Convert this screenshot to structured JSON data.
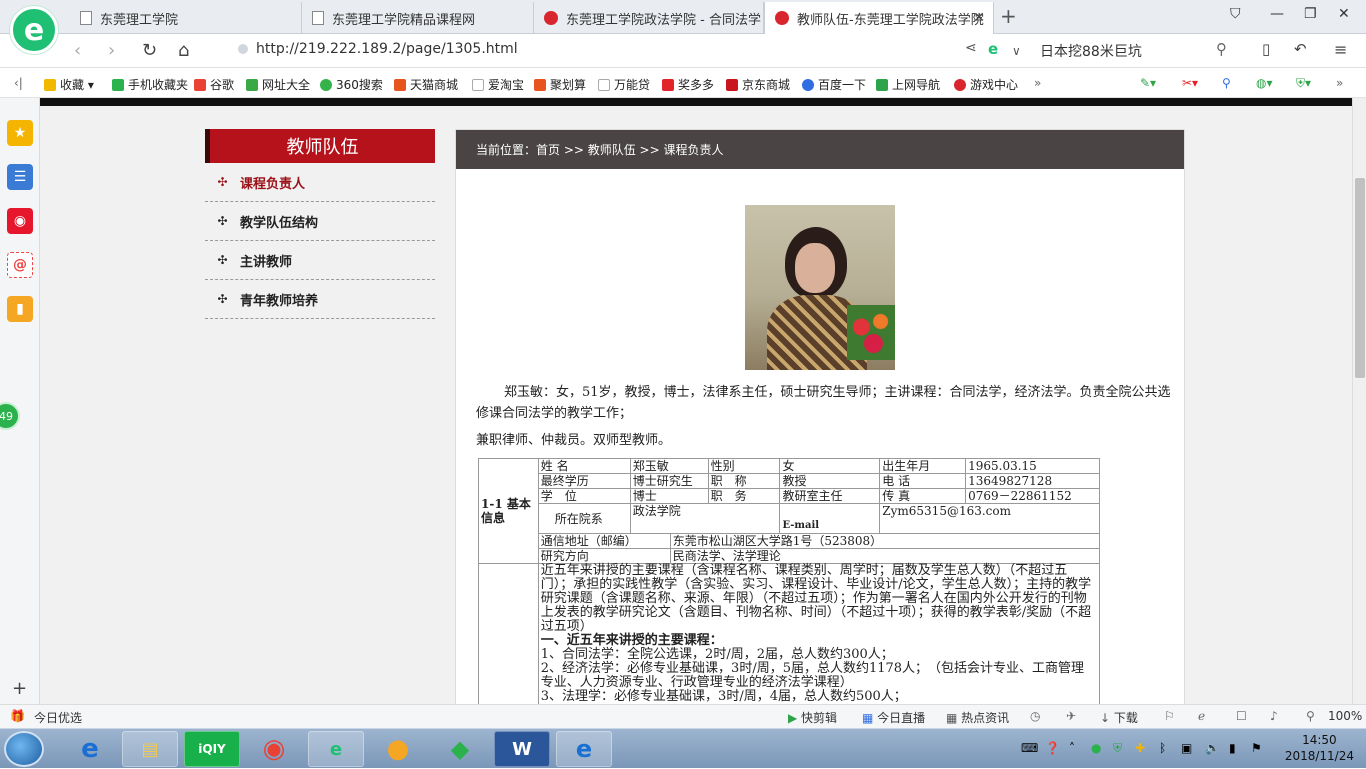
{
  "browser": {
    "tabs": [
      {
        "label": "东莞理工学院"
      },
      {
        "label": "东莞理工学院精品课程网"
      },
      {
        "label": "东莞理工学院政法学院 - 合同法学"
      },
      {
        "label": "教师队伍-东莞理工学院政法学院"
      }
    ],
    "url": "http://219.222.189.2/page/1305.html",
    "search_query": "日本挖88米巨坑",
    "bookmarks": [
      "收藏",
      "手机收藏夹",
      "谷歌",
      "网址大全",
      "360搜索",
      "天猫商城",
      "爱淘宝",
      "聚划算",
      "万能贷",
      "奖多多",
      "京东商城",
      "百度一下",
      "上网导航",
      "游戏中心"
    ],
    "side_badge": "49"
  },
  "page": {
    "left_title": "教师队伍",
    "menu": [
      {
        "label": "课程负责人",
        "active": true
      },
      {
        "label": "教学队伍结构",
        "active": false
      },
      {
        "label": "主讲教师",
        "active": false
      },
      {
        "label": "青年教师培养",
        "active": false
      }
    ],
    "breadcrumb": "当前位置：首页 >> 教师队伍 >> 课程负责人",
    "bio": "郑玉敏：女，51岁，教授，博士，法律系主任，硕士研究生导师；主讲课程：合同法学，经济法学。负责全院公共选修课合同法学的教学工作；",
    "bio2": "兼职律师、仲裁员。双师型教师。",
    "table": {
      "section_label": "1-1 基本信息",
      "name_label": "姓 名",
      "name": "郑玉敏",
      "gender_label": "性别",
      "gender": "女",
      "birth_label": "出生年月",
      "birth": "1965.03.15",
      "edu_label": "最终学历",
      "edu": "博士研究生",
      "title_label": "职　称",
      "title": "教授",
      "phone_label": "电 话",
      "phone": "13649827128",
      "degree_label": "学　位",
      "degree": "博士",
      "post_label": "职　务",
      "post": "教研室主任",
      "fax_label": "传 真",
      "fax": "0769－22861152",
      "dept_label": "所在院系",
      "dept": "政法学院",
      "email_label": "E-mail",
      "email": "Zym65315@163.com",
      "addr_label": "通信地址（邮编）",
      "addr": "东莞市松山湖区大学路1号（523808）",
      "research_label": "研究方向",
      "research": "民商法学、法学理论",
      "instructions": "近五年来讲授的主要课程（含课程名称、课程类别、周学时；届数及学生总人数）（不超过五门）；承担的实践性教学（含实验、实习、课程设计、毕业设计/论文，学生总人数）；主持的教学研究课题（含课题名称、来源、年限）（不超过五项）；作为第一署名人在国内外公开发行的刊物上发表的教学研究论文（含题目、刊物名称、时间）（不超过十项）；获得的教学表彰/奖励（不超过五项）",
      "courses_heading": "一、近五年来讲授的主要课程：",
      "course1": "1、合同法学：全院公选课，2时/周，2届，总人数约300人；",
      "course2": "2、经济法学：必修专业基础课，3时/周，5届，总人数约1178人；　（包括会计专业、工商管理专业、人力资源专业、行政管理专业的经济法学课程）",
      "course3": "3、法理学：必修专业基础课，3时/周，4届，总人数约500人；"
    }
  },
  "statusbar": {
    "left": "今日优选",
    "items": [
      "快剪辑",
      "今日直播",
      "热点资讯",
      "下载"
    ],
    "zoom": "100%"
  },
  "taskbar": {
    "time": "14:50",
    "date": "2018/11/24"
  }
}
